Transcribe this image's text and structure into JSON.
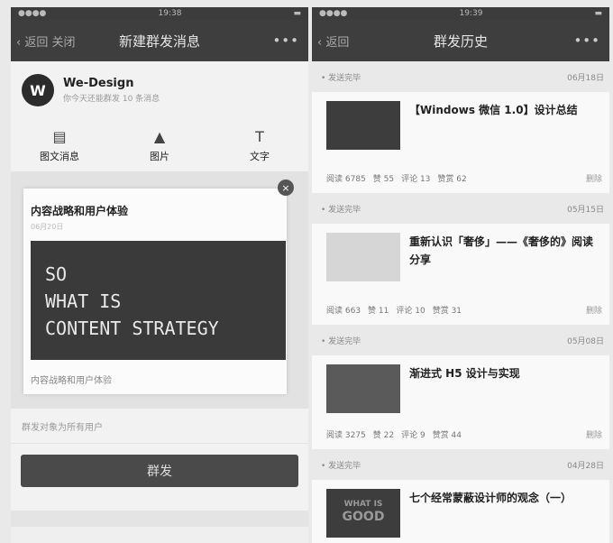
{
  "left": {
    "time": "19:38",
    "back": "返回 关闭",
    "title": "新建群发消息",
    "more": "•••",
    "account": {
      "avatar_letter": "W",
      "name": "We-Design",
      "sub": "你今天还能群发 10 条消息"
    },
    "types": [
      {
        "label": "图文消息",
        "icon": "article-icon"
      },
      {
        "label": "图片",
        "icon": "image-icon"
      },
      {
        "label": "文字",
        "icon": "text-icon"
      }
    ],
    "card": {
      "title": "内容战略和用户体验",
      "date": "06月20日",
      "banner_lines": [
        "SO",
        "WHAT IS",
        "CONTENT STRATEGY"
      ],
      "caption": "内容战略和用户体验"
    },
    "target": "群发对象为所有用户",
    "send": "群发"
  },
  "right": {
    "time": "19:39",
    "back": "返回",
    "title": "群发历史",
    "more": "•••",
    "sections": [
      {
        "status": "• 发送完毕",
        "date": "06月18日",
        "title": "【Windows 微信 1.0】设计总结",
        "reads": "阅读 6785",
        "likes": "赞 55",
        "comments": "评论 13",
        "rewards": "赞赏 62",
        "delete": "删除"
      },
      {
        "status": "• 发送完毕",
        "date": "05月15日",
        "title": "重新认识「奢侈」——《奢侈的》阅读分享",
        "reads": "阅读 663",
        "likes": "赞 11",
        "comments": "评论 10",
        "rewards": "赞赏 31",
        "delete": "删除"
      },
      {
        "status": "• 发送完毕",
        "date": "05月08日",
        "title": "渐进式 H5 设计与实现",
        "reads": "阅读 3275",
        "likes": "赞 22",
        "comments": "评论 9",
        "rewards": "赞赏 44",
        "delete": "删除"
      },
      {
        "status": "• 发送完毕",
        "date": "04月28日",
        "title": "七个经常蒙蔽设计师的观念（一）",
        "thumb_text": [
          "WHAT IS",
          "GOOD"
        ]
      }
    ]
  }
}
